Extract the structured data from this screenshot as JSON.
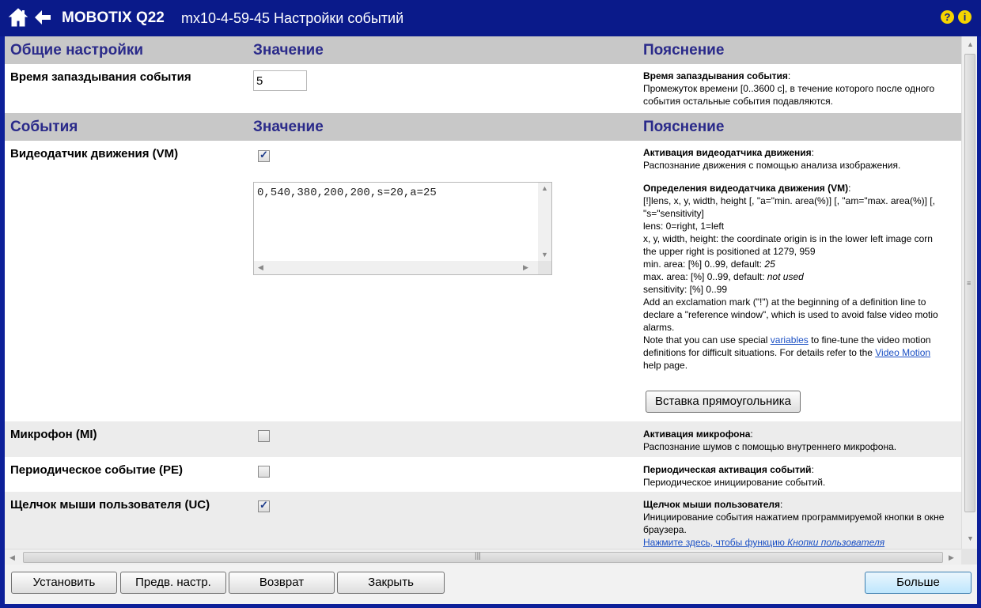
{
  "header": {
    "brand": "MOBOTIX Q22",
    "title": "mx10-4-59-45 Настройки событий",
    "help_icon": "?",
    "info_icon": "i"
  },
  "general": {
    "head_col1": "Общие настройки",
    "head_col2": "Значение",
    "head_col3": "Пояснение",
    "delay_label": "Время запаздывания события",
    "delay_value": "5",
    "delay_explain_title": "Время запаздывания события",
    "delay_explain_text": "Промежуток времени [0..3600 с], в течение которого после одного события остальные события подавляются."
  },
  "events": {
    "head_col1": "События",
    "head_col2": "Значение",
    "head_col3": "Пояснение",
    "vm": {
      "label": "Видеодатчик движения (VM)",
      "checked": true,
      "definition": "0,540,380,200,200,s=20,a=25",
      "explain_title": "Активация видеодатчика движения",
      "explain_text": "Распознание движения с помощью анализа изображения.",
      "def_title": "Определения видеодатчика движения (VM)",
      "def_lines": [
        "[!]lens, x, y, width, height [, \"a=\"min. area(%)] [, \"am=\"max. area(%)] [,",
        "\"s=\"sensitivity]",
        "lens: 0=right, 1=left",
        "x, y, width, height: the coordinate origin is in the lower left image corn",
        "the upper right is positioned at 1279, 959"
      ],
      "min_area_prefix": "min. area: [%] 0..99, default: ",
      "min_area_default": "25",
      "max_area_prefix": "max. area: [%] 0..99, default: ",
      "max_area_default": "not used",
      "sensitivity": "sensitivity: [%] 0..99",
      "excl_lines": [
        "Add an exclamation mark (\"!\") at the beginning of a definition line to",
        "declare a \"reference window\", which is used to avoid false video motio",
        "alarms."
      ],
      "note_prefix": "Note that you can use special ",
      "note_link1": "variables",
      "note_mid": " to fine-tune the video motion",
      "note_line2_prefix": "definitions for difficult situations. For details refer to the ",
      "note_link2": "Video Motion",
      "note_line3": "help page.",
      "insert_button": "Вставка прямоугольника"
    },
    "mi": {
      "label": "Микрофон (MI)",
      "checked": false,
      "explain_title": "Активация микрофона",
      "explain_text": "Распознание шумов с помощью внутреннего микрофона."
    },
    "pe": {
      "label": "Периодическое событие (PE)",
      "checked": false,
      "explain_title": "Периодическая активация событий",
      "explain_text": "Периодическое инициирование событий."
    },
    "uc": {
      "label": "Щелчок мыши пользователя (UC)",
      "checked": true,
      "explain_title": "Щелчок мыши пользователя",
      "explain_text": "Инициирование события нажатием программируемой кнопки в окне",
      "explain_text2": "браузера.",
      "link_prefix": "Нажмите здесь, чтобы функцию ",
      "link_em": "Кнопки пользователя"
    }
  },
  "footer": {
    "set": "Установить",
    "defaults": "Предв. настр.",
    "restore": "Возврат",
    "close": "Закрыть",
    "more": "Больше"
  },
  "colors": {
    "header_bg": "#0a1a8a",
    "section_head_text": "#2a2a8a",
    "link": "#1a4fc4"
  }
}
